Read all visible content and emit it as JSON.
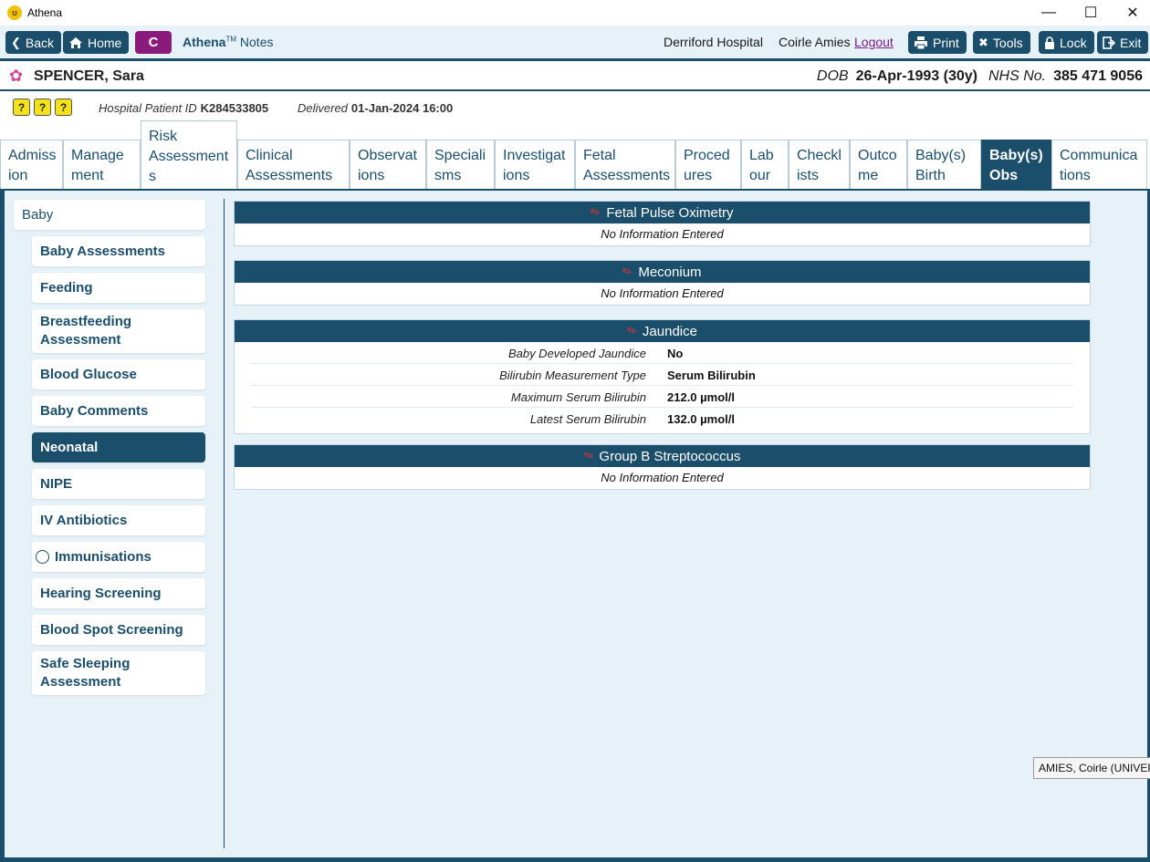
{
  "window": {
    "title": "Athena",
    "icon": "athena-logo-icon",
    "controls": [
      "minimize-icon",
      "maximize-icon",
      "close-icon"
    ]
  },
  "toolbar": {
    "back_label": "Back",
    "home_label": "Home",
    "c_label": "C",
    "app_name": "Athena",
    "trademark": "TM",
    "app_module": "Notes",
    "hospital": "Derriford Hospital",
    "user": "Coirle Amies",
    "logout_label": "Logout",
    "print_label": "Print",
    "tools_label": "Tools",
    "lock_label": "Lock",
    "exit_label": "Exit"
  },
  "patient": {
    "name": "SPENCER, Sara",
    "dob_label": "DOB",
    "dob_value": "26-Apr-1993 (30y)",
    "nhs_label": "NHS No.",
    "nhs_value": "385 471 9056",
    "hospital_id_label": "Hospital Patient ID",
    "hospital_id_value": "K284533805",
    "delivered_label": "Delivered",
    "delivered_value": "01-Jan-2024 16:00"
  },
  "alerts": [
    "?",
    "?",
    "?"
  ],
  "tabs": [
    {
      "line1": "Admiss",
      "line2": "ion"
    },
    {
      "line1": "Manage",
      "line2": "ment"
    },
    {
      "line1": "Risk",
      "line2": "Assessment",
      "line3": "s"
    },
    {
      "line1": "Clinical",
      "line2": "Assessments"
    },
    {
      "line1": "Observat",
      "line2": "ions"
    },
    {
      "line1": "Speciali",
      "line2": "sms"
    },
    {
      "line1": "Investigat",
      "line2": "ions"
    },
    {
      "line1": "Fetal",
      "line2": "Assessments"
    },
    {
      "line1": "Proced",
      "line2": "ures"
    },
    {
      "line1": "Lab",
      "line2": "our"
    },
    {
      "line1": "Checkl",
      "line2": "ists"
    },
    {
      "line1": "Outco",
      "line2": "me"
    },
    {
      "line1": "Baby(s)",
      "line2": "Birth"
    },
    {
      "line1": "Baby(s)",
      "line2": "Obs"
    },
    {
      "line1": "Communica",
      "line2": "tions"
    }
  ],
  "sidenav": {
    "parent": "Baby",
    "items": [
      "Baby Assessments",
      "Feeding",
      "Breastfeeding Assessment",
      "Blood Glucose",
      "Baby Comments",
      "Neonatal",
      "NIPE",
      "IV Antibiotics",
      "Immunisations",
      "Hearing Screening",
      "Blood Spot Screening",
      "Safe Sleeping Assessment"
    ]
  },
  "panels": {
    "fetal_pulse": {
      "title": "Fetal Pulse Oximetry",
      "empty": "No Information Entered"
    },
    "meconium": {
      "title": "Meconium",
      "empty": "No Information Entered"
    },
    "jaundice": {
      "title": "Jaundice",
      "rows": [
        {
          "label": "Baby Developed Jaundice",
          "value": "No"
        },
        {
          "label": "Bilirubin Measurement Type",
          "value": "Serum Bilirubin"
        },
        {
          "label": "Maximum Serum Bilirubin",
          "value": "212.0 µmol/l"
        },
        {
          "label": "Latest Serum Bilirubin",
          "value": "132.0 µmol/l"
        }
      ]
    },
    "gbs": {
      "title": "Group B Streptococcus",
      "empty": "No Information Entered"
    }
  },
  "tooltip": "AMIES, Coirle (UNIVERS"
}
